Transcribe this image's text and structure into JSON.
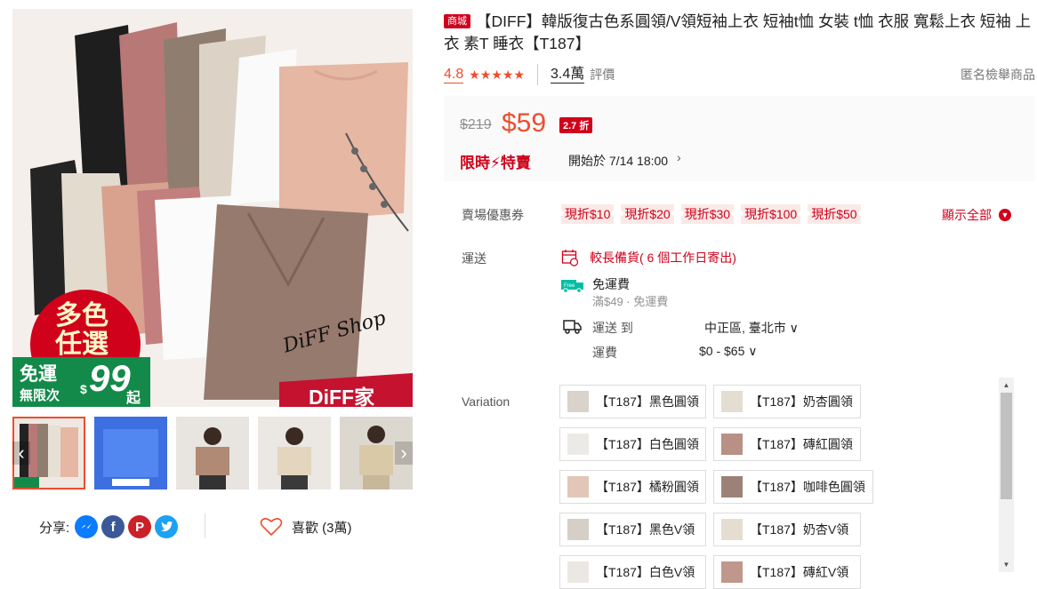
{
  "gallery": {
    "main_overlays": {
      "colors_badge_line1": "多色",
      "colors_badge_line2": "任選",
      "free_ship_line1": "免運",
      "free_ship_line2": "無限次",
      "free_ship_amount": "99",
      "free_ship_dollar": "$",
      "free_ship_suffix": "起",
      "shop_script": "DiFF Shop",
      "brand_banner": "DiFF家"
    },
    "thumb_count": 5
  },
  "share": {
    "label": "分享:",
    "icons": [
      "messenger-icon",
      "facebook-icon",
      "pinterest-icon",
      "twitter-icon"
    ]
  },
  "like": {
    "label": "喜歡 (3萬)"
  },
  "product": {
    "mall_badge": "商城",
    "title": "【DIFF】韓版復古色系圓領/V領短袖上衣 短袖t恤 女裝 t恤 衣服 寬鬆上衣 短袖 上衣 素T 睡衣【T187】",
    "rating": "4.8",
    "stars": "★★★★★",
    "review_count": "3.4萬",
    "review_label": "評價",
    "report": "匿名檢舉商品"
  },
  "price": {
    "original": "$219",
    "current": "$59",
    "discount": "2.7 折",
    "flash_label": "限時⚡特賣",
    "flash_time": "開始於 7/14 18:00",
    "flash_arrow": "›"
  },
  "vouchers": {
    "label": "賣場優惠券",
    "items": [
      "現折$10",
      "現折$20",
      "現折$30",
      "現折$100",
      "現折$50"
    ],
    "show_all": "顯示全部"
  },
  "shipping": {
    "label": "運送",
    "late_notice": "較長備貨( 6 個工作日寄出)",
    "free_title": "免運費",
    "free_sub": "滿$49 · 免運費",
    "ship_to_label": "運送 到",
    "ship_to_value": "中正區, 臺北市 ∨",
    "fee_label": "運費",
    "fee_value": "$0 - $65 ∨"
  },
  "variation": {
    "label": "Variation",
    "options": [
      "【T187】黑色圓領",
      "【T187】奶杏圓領",
      "【T187】白色圓領",
      "【T187】磚紅圓領",
      "【T187】橘粉圓領",
      "【T187】咖啡色圓領",
      "【T187】黑色V領",
      "【T187】奶杏V領",
      "【T187】白色V領",
      "【T187】磚紅V領"
    ]
  },
  "colors": {
    "accent": "#ee4d2d",
    "mall_red": "#d0011b",
    "price_bg": "#fafafa"
  }
}
